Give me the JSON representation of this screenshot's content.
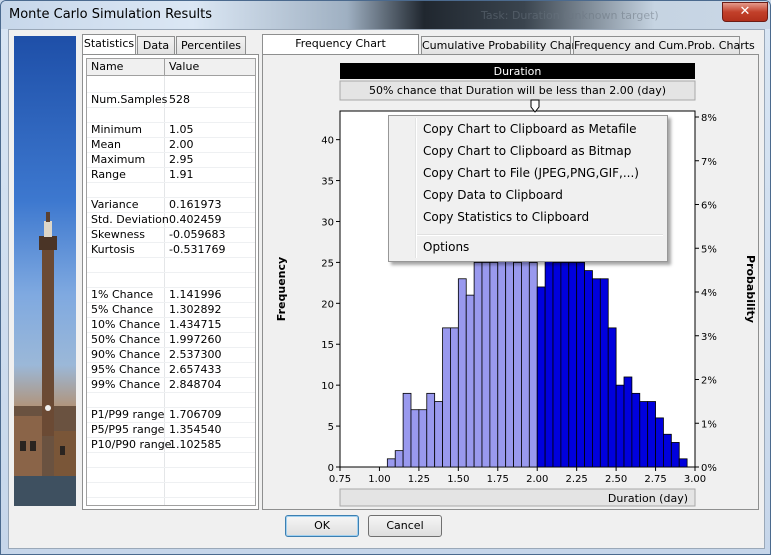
{
  "window": {
    "title": "Monte Carlo Simulation Results",
    "ghost_title": "Task: Duration (unknown target)",
    "close_glyph": "✕"
  },
  "left_tabs": [
    "Statistics",
    "Data",
    "Percentiles"
  ],
  "right_tabs": [
    "Frequency Chart",
    "Cumulative Probability Chart",
    "Frequency and Cum.Prob. Charts"
  ],
  "stats": {
    "col_name": "Name",
    "col_value": "Value",
    "rows": [
      {
        "name": "",
        "value": ""
      },
      {
        "name": "Num.Samples",
        "value": "528"
      },
      {
        "name": "",
        "value": ""
      },
      {
        "name": "Minimum",
        "value": "1.05"
      },
      {
        "name": "Mean",
        "value": "2.00"
      },
      {
        "name": "Maximum",
        "value": "2.95"
      },
      {
        "name": "Range",
        "value": "1.91"
      },
      {
        "name": "",
        "value": ""
      },
      {
        "name": "Variance",
        "value": "0.161973"
      },
      {
        "name": "Std. Deviation",
        "value": "0.402459"
      },
      {
        "name": "Skewness",
        "value": "-0.059683"
      },
      {
        "name": "Kurtosis",
        "value": "-0.531769"
      },
      {
        "name": "",
        "value": ""
      },
      {
        "name": "",
        "value": ""
      },
      {
        "name": "1% Chance",
        "value": "1.141996"
      },
      {
        "name": "5% Chance",
        "value": "1.302892"
      },
      {
        "name": "10% Chance",
        "value": "1.434715"
      },
      {
        "name": "50% Chance",
        "value": "1.997260"
      },
      {
        "name": "90% Chance",
        "value": "2.537300"
      },
      {
        "name": "95% Chance",
        "value": "2.657433"
      },
      {
        "name": "99% Chance",
        "value": "2.848704"
      },
      {
        "name": "",
        "value": ""
      },
      {
        "name": "P1/P99 range",
        "value": "1.706709"
      },
      {
        "name": "P5/P95 range",
        "value": "1.354540"
      },
      {
        "name": "P10/P90 range",
        "value": "1.102585"
      },
      {
        "name": "",
        "value": ""
      },
      {
        "name": "",
        "value": ""
      },
      {
        "name": "",
        "value": ""
      },
      {
        "name": "",
        "value": ""
      }
    ]
  },
  "chart": {
    "title": "Duration",
    "subtitle": "50% chance that Duration will be less than 2.00 (day)",
    "xlabel": "Duration (day)",
    "ylabel_left": "Frequency",
    "ylabel_right": "Probability",
    "colors": {
      "below": "#9999ee",
      "above": "#0000dd",
      "bar_border": "#000000",
      "title_bg": "#000000"
    }
  },
  "chart_data": {
    "type": "bar",
    "x_start": [
      0.75,
      0.8,
      0.85,
      0.9,
      0.95,
      1.0,
      1.05,
      1.1,
      1.15,
      1.2,
      1.25,
      1.3,
      1.35,
      1.4,
      1.45,
      1.5,
      1.55,
      1.6,
      1.65,
      1.7,
      1.75,
      1.8,
      1.85,
      1.9,
      1.95,
      2.0,
      2.05,
      2.1,
      2.15,
      2.2,
      2.25,
      2.3,
      2.35,
      2.4,
      2.45,
      2.5,
      2.55,
      2.6,
      2.65,
      2.7,
      2.75,
      2.8,
      2.85,
      2.9,
      2.95
    ],
    "bin_width": 0.05,
    "values": [
      0,
      0,
      0,
      0,
      0,
      0,
      1,
      2,
      9,
      7,
      7,
      9,
      8,
      17,
      17,
      23,
      21,
      25,
      25,
      25,
      26,
      26,
      25,
      26,
      25,
      22,
      26,
      25,
      25,
      25,
      25,
      24,
      23,
      23,
      17,
      10,
      11,
      9,
      8,
      8,
      6,
      4,
      3,
      1,
      0
    ],
    "split_at": 2.0,
    "xlim": [
      0.75,
      3.0
    ],
    "ylim": [
      0,
      43.5
    ],
    "x_ticks": [
      "0.75",
      "1.00",
      "1.25",
      "1.50",
      "1.75",
      "2.00",
      "2.25",
      "2.50",
      "2.75",
      "3.00"
    ],
    "y_ticks_left": [
      "0",
      "5",
      "10",
      "15",
      "20",
      "25",
      "30",
      "35",
      "40"
    ],
    "y_ticks_right": [
      "0%",
      "1%",
      "2%",
      "3%",
      "4%",
      "5%",
      "6%",
      "7%",
      "8%"
    ]
  },
  "context_menu": {
    "items": [
      "Copy Chart to Clipboard as Metafile",
      "Copy Chart to Clipboard as Bitmap",
      "Copy Chart to File (JPEG,PNG,GIF,...)",
      "Copy Data to Clipboard",
      "Copy Statistics to Clipboard",
      "Options"
    ]
  },
  "buttons": {
    "ok": "OK",
    "cancel": "Cancel"
  }
}
